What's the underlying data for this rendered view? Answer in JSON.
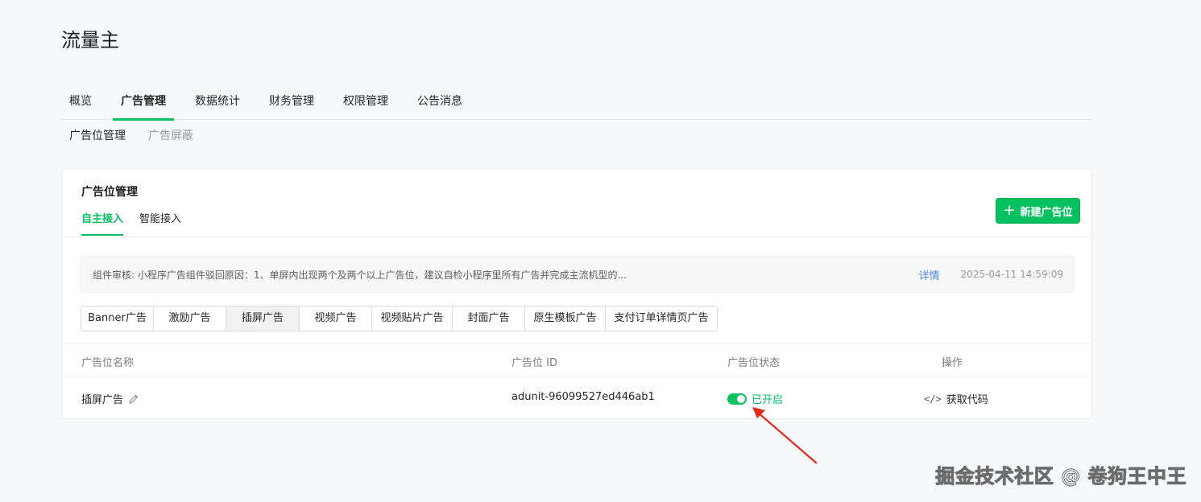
{
  "app_title": "流量主",
  "main_tabs": [
    {
      "label": "概览",
      "active": false
    },
    {
      "label": "广告管理",
      "active": true
    },
    {
      "label": "数据统计",
      "active": false
    },
    {
      "label": "财务管理",
      "active": false
    },
    {
      "label": "权限管理",
      "active": false
    },
    {
      "label": "公告消息",
      "active": false
    }
  ],
  "sub_tabs": [
    {
      "label": "广告位管理",
      "active": true
    },
    {
      "label": "广告屏蔽",
      "active": false
    }
  ],
  "card": {
    "title": "广告位管理",
    "tabs": [
      {
        "label": "自主接入",
        "active": true
      },
      {
        "label": "智能接入",
        "active": false
      }
    ],
    "new_button_label": "新建广告位"
  },
  "notice": {
    "text": "组件审核: 小程序广告组件驳回原因：1、单屏内出现两个及两个以上广告位，建议自检小程序里所有广告并完成主流机型的...",
    "link_label": "详情",
    "timestamp": "2025-04-11 14:59:09"
  },
  "ad_types": [
    {
      "label": "Banner广告",
      "active": false
    },
    {
      "label": "激励广告",
      "active": false
    },
    {
      "label": "插屏广告",
      "active": true
    },
    {
      "label": "视频广告",
      "active": false
    },
    {
      "label": "视频贴片广告",
      "active": false
    },
    {
      "label": "封面广告",
      "active": false
    },
    {
      "label": "原生模板广告",
      "active": false
    },
    {
      "label": "支付订单详情页广告",
      "active": false
    }
  ],
  "table": {
    "columns": [
      "广告位名称",
      "广告位 ID",
      "广告位状态",
      "操作"
    ],
    "rows": [
      {
        "name": "插屏广告",
        "id": "adunit-96099527ed446ab1",
        "status": "已开启",
        "status_on": true,
        "action": "获取代码"
      }
    ]
  },
  "watermark": "掘金技术社区 @ 卷狗王中王",
  "colors": {
    "accent": "#07c160",
    "link": "#4a8ad6",
    "annotation_arrow": "#e02b20"
  },
  "icons": {
    "edit": "pencil-icon",
    "code": "code-icon",
    "add": "plus-icon"
  }
}
